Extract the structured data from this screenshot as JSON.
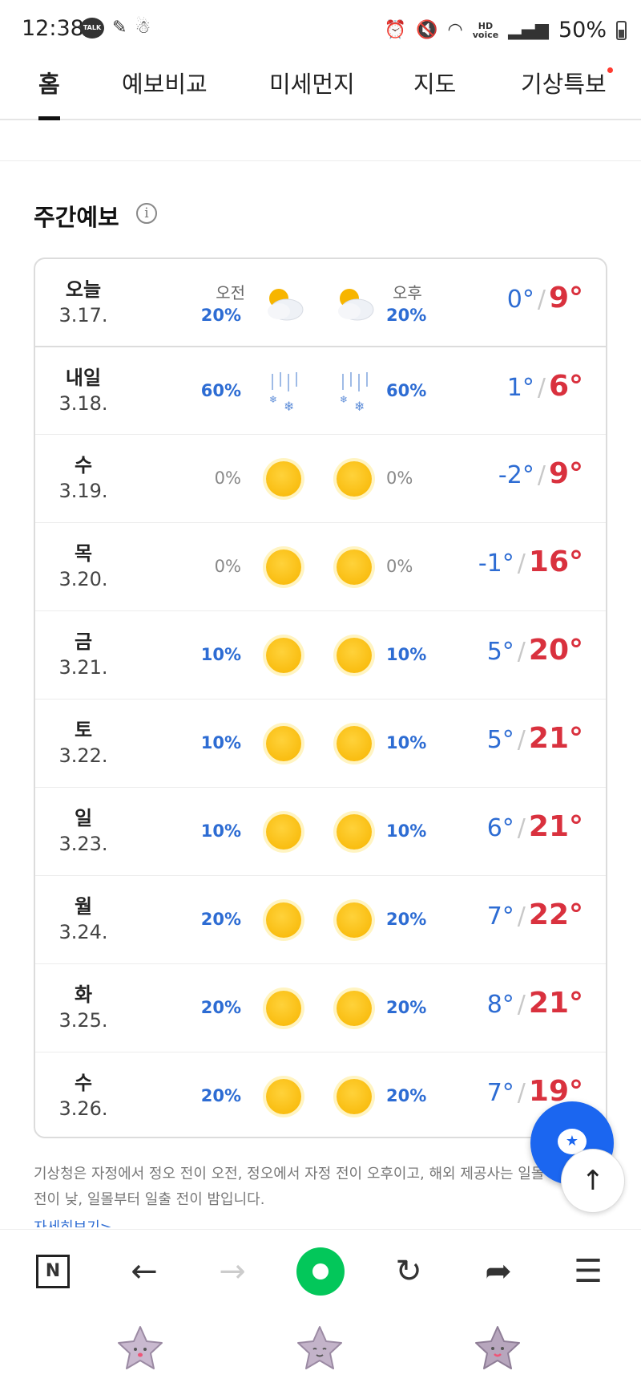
{
  "status": {
    "time": "12:38",
    "talk_label": "TALK",
    "battery": "50%",
    "hd": "HD",
    "voice": "voice"
  },
  "tabs": [
    {
      "label": "홈",
      "active": true
    },
    {
      "label": "예보비교"
    },
    {
      "label": "미세먼지"
    },
    {
      "label": "지도"
    },
    {
      "label": "기상특보",
      "badge": true
    }
  ],
  "section": {
    "title": "주간예보",
    "info_icon": "info-icon"
  },
  "forecast": {
    "am_label": "오전",
    "pm_label": "오후",
    "rows": [
      {
        "day": "오늘",
        "date": "3.17.",
        "am_pop": "20%",
        "pm_pop": "20%",
        "am_icon": "partly-cloudy",
        "pm_icon": "partly-cloudy",
        "min": "0°",
        "max": "9°"
      },
      {
        "day": "내일",
        "date": "3.18.",
        "am_pop": "60%",
        "pm_pop": "60%",
        "am_icon": "sleet",
        "pm_icon": "sleet",
        "min": "1°",
        "max": "6°"
      },
      {
        "day": "수",
        "date": "3.19.",
        "am_pop": "0%",
        "pm_pop": "0%",
        "am_icon": "sunny",
        "pm_icon": "sunny",
        "min": "-2°",
        "max": "9°"
      },
      {
        "day": "목",
        "date": "3.20.",
        "am_pop": "0%",
        "pm_pop": "0%",
        "am_icon": "sunny",
        "pm_icon": "sunny",
        "min": "-1°",
        "max": "16°"
      },
      {
        "day": "금",
        "date": "3.21.",
        "am_pop": "10%",
        "pm_pop": "10%",
        "am_icon": "sunny",
        "pm_icon": "sunny",
        "min": "5°",
        "max": "20°"
      },
      {
        "day": "토",
        "date": "3.22.",
        "am_pop": "10%",
        "pm_pop": "10%",
        "am_icon": "sunny",
        "pm_icon": "sunny",
        "min": "5°",
        "max": "21°"
      },
      {
        "day": "일",
        "date": "3.23.",
        "am_pop": "10%",
        "pm_pop": "10%",
        "am_icon": "sunny",
        "pm_icon": "sunny",
        "min": "6°",
        "max": "21°"
      },
      {
        "day": "월",
        "date": "3.24.",
        "am_pop": "20%",
        "pm_pop": "20%",
        "am_icon": "sunny",
        "pm_icon": "sunny",
        "min": "7°",
        "max": "22°"
      },
      {
        "day": "화",
        "date": "3.25.",
        "am_pop": "20%",
        "pm_pop": "20%",
        "am_icon": "sunny",
        "pm_icon": "sunny",
        "min": "8°",
        "max": "21°"
      },
      {
        "day": "수",
        "date": "3.26.",
        "am_pop": "20%",
        "pm_pop": "20%",
        "am_icon": "sunny",
        "pm_icon": "sunny",
        "min": "7°",
        "max": "19°"
      }
    ]
  },
  "footnote": "기상청은 자정에서 정오 전이 오전, 정오에서 자정 전이 오후이고, 해외 제공사는 일몰 전이 낮, 일몰부터 일출 전이 밤입니다.",
  "more_link": "자세히보기>",
  "toolbar": {
    "home_label": "N",
    "back_icon": "back-arrow-icon",
    "forward_icon": "forward-arrow-icon",
    "reload_icon": "reload-icon",
    "share_icon": "share-icon",
    "menu_icon": "menu-icon"
  },
  "colors": {
    "accent": "#2d6cd3",
    "max_temp": "#d9313e",
    "fab": "#1b66f0",
    "naver_green": "#03c75a"
  }
}
